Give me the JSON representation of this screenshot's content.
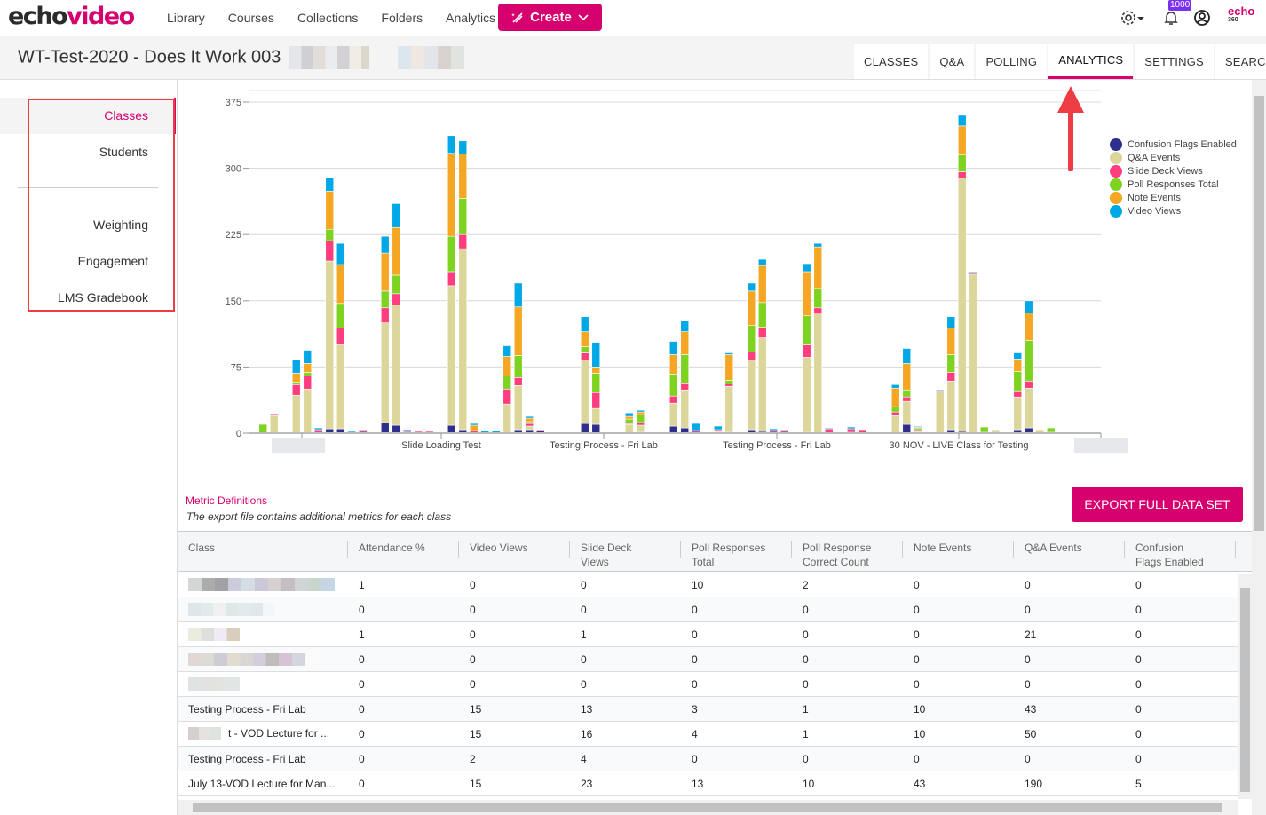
{
  "app": {
    "logo": {
      "part1": "echo",
      "part2": "video"
    },
    "nav": [
      "Library",
      "Courses",
      "Collections",
      "Folders",
      "Analytics"
    ],
    "create_label": "Create",
    "notification_count": "1000",
    "brand_small": {
      "top": "echo",
      "bottom": "360"
    },
    "accent_color": "#d6006f"
  },
  "course": {
    "title": "WT-Test-2020 - Does It Work 003"
  },
  "tabs": [
    {
      "label": "CLASSES",
      "active": false
    },
    {
      "label": "Q&A",
      "active": false
    },
    {
      "label": "POLLING",
      "active": false
    },
    {
      "label": "ANALYTICS",
      "active": true
    },
    {
      "label": "SETTINGS",
      "active": false
    },
    {
      "label": "SEARCH",
      "active": false
    }
  ],
  "sidebar": {
    "items": [
      {
        "label": "Classes",
        "active": true
      },
      {
        "label": "Students",
        "active": false
      },
      {
        "label": "Weighting",
        "active": false
      },
      {
        "label": "Engagement",
        "active": false
      },
      {
        "label": "LMS Gradebook",
        "active": false
      }
    ]
  },
  "chart_data": {
    "type": "bar",
    "stacked": true,
    "title": "",
    "xlabel": "",
    "ylabel": "",
    "ylim": [
      0,
      375
    ],
    "yticks": [
      0,
      75,
      150,
      225,
      300,
      375
    ],
    "grid": true,
    "legend_position": "right",
    "x_tick_labels": [
      "",
      "Slide Loading Test",
      "Testing Process - Fri Lab",
      "Testing Process - Fri Lab",
      "30 NOV - LIVE Class for Testing",
      ""
    ],
    "series": [
      {
        "name": "Confusion Flags Enabled",
        "color": "#2e2e8f"
      },
      {
        "name": "Q&A Events",
        "color": "#dcd69a"
      },
      {
        "name": "Slide Deck Views",
        "color": "#ff3d7f"
      },
      {
        "name": "Poll Responses Total",
        "color": "#7ed321"
      },
      {
        "name": "Note Events",
        "color": "#f5a623"
      },
      {
        "name": "Video Views",
        "color": "#00a8e6"
      }
    ],
    "bars": [
      [
        0,
        0,
        0,
        10,
        0,
        0
      ],
      [
        0,
        20,
        2,
        0,
        0,
        0
      ],
      [
        0,
        0,
        0,
        0,
        0,
        0
      ],
      [
        0,
        43,
        12,
        3,
        10,
        15
      ],
      [
        0,
        50,
        15,
        4,
        10,
        15
      ],
      [
        0,
        0,
        4,
        0,
        0,
        2
      ],
      [
        5,
        190,
        23,
        13,
        43,
        15
      ],
      [
        5,
        95,
        19,
        28,
        44,
        24
      ],
      [
        0,
        0,
        0,
        0,
        0,
        2
      ],
      [
        0,
        0,
        3,
        0,
        0,
        1
      ],
      [
        0,
        0,
        0,
        0,
        0,
        1
      ],
      [
        12,
        113,
        17,
        19,
        43,
        19
      ],
      [
        9,
        136,
        13,
        21,
        54,
        27
      ],
      [
        0,
        0,
        2,
        0,
        0,
        2
      ],
      [
        0,
        0,
        2,
        0,
        0,
        0
      ],
      [
        0,
        0,
        2,
        0,
        0,
        0
      ],
      [
        0,
        0,
        0,
        0,
        0,
        1
      ],
      [
        9,
        158,
        16,
        40,
        94,
        20
      ],
      [
        4,
        205,
        16,
        41,
        50,
        15
      ],
      [
        0,
        0,
        3,
        0,
        6,
        2
      ],
      [
        0,
        0,
        0,
        0,
        0,
        3
      ],
      [
        0,
        0,
        0,
        0,
        0,
        3
      ],
      [
        0,
        33,
        17,
        15,
        22,
        12
      ],
      [
        4,
        50,
        9,
        25,
        55,
        27
      ],
      [
        4,
        4,
        3,
        2,
        4,
        2
      ],
      [
        3,
        0,
        1,
        0,
        0,
        0
      ],
      [
        0,
        0,
        0,
        0,
        0,
        0
      ],
      [
        0,
        0,
        0,
        0,
        0,
        0
      ],
      [
        0,
        0,
        0,
        0,
        0,
        0
      ],
      [
        11,
        72,
        8,
        7,
        17,
        17
      ],
      [
        10,
        18,
        18,
        22,
        7,
        28
      ],
      [
        0,
        0,
        0,
        0,
        0,
        0
      ],
      [
        0,
        0,
        0,
        0,
        0,
        0
      ],
      [
        0,
        10,
        1,
        5,
        3,
        4
      ],
      [
        1,
        8,
        3,
        9,
        3,
        2
      ],
      [
        0,
        0,
        0,
        0,
        0,
        1
      ],
      [
        0,
        0,
        0,
        0,
        0,
        0
      ],
      [
        8,
        26,
        8,
        25,
        22,
        15
      ],
      [
        6,
        43,
        8,
        32,
        26,
        12
      ],
      [
        0,
        0,
        3,
        0,
        0,
        8
      ],
      [
        0,
        0,
        1,
        0,
        0,
        0
      ],
      [
        0,
        2,
        2,
        0,
        0,
        4
      ],
      [
        1,
        52,
        3,
        4,
        29,
        2
      ],
      [
        0,
        0,
        0,
        0,
        0,
        0
      ],
      [
        4,
        79,
        9,
        30,
        39,
        9
      ],
      [
        2,
        106,
        12,
        28,
        42,
        7
      ],
      [
        0,
        0,
        3,
        0,
        0,
        2
      ],
      [
        0,
        0,
        3,
        0,
        0,
        1
      ],
      [
        0,
        0,
        0,
        0,
        0,
        0
      ],
      [
        1,
        85,
        14,
        33,
        50,
        9
      ],
      [
        0,
        135,
        7,
        22,
        47,
        4
      ],
      [
        0,
        0,
        5,
        0,
        0,
        1
      ],
      [
        0,
        0,
        0,
        0,
        0,
        0
      ],
      [
        1,
        0,
        4,
        0,
        0,
        2
      ],
      [
        0,
        0,
        4,
        0,
        0,
        0
      ],
      [
        0,
        0,
        0,
        0,
        0,
        0
      ],
      [
        0,
        0,
        0,
        0,
        0,
        0
      ],
      [
        0,
        20,
        4,
        6,
        21,
        4
      ],
      [
        10,
        26,
        5,
        8,
        30,
        17
      ],
      [
        0,
        2,
        2,
        2,
        1,
        1
      ],
      [
        0,
        0,
        0,
        0,
        0,
        0
      ],
      [
        0,
        47,
        1,
        0,
        0,
        1
      ],
      [
        4,
        55,
        10,
        20,
        30,
        13
      ],
      [
        2,
        287,
        7,
        19,
        33,
        12
      ],
      [
        0,
        180,
        2,
        0,
        0,
        1
      ],
      [
        0,
        0,
        1,
        6,
        0,
        0
      ],
      [
        0,
        4,
        0,
        0,
        0,
        0
      ],
      [
        0,
        0,
        0,
        0,
        0,
        0
      ],
      [
        4,
        37,
        7,
        22,
        14,
        7
      ],
      [
        6,
        45,
        8,
        46,
        31,
        14
      ],
      [
        0,
        3,
        0,
        0,
        1,
        0
      ],
      [
        0,
        0,
        1,
        5,
        0,
        0
      ],
      [
        0,
        0,
        0,
        0,
        0,
        0
      ],
      [
        0,
        0,
        0,
        0,
        0,
        0
      ],
      [
        0,
        0,
        0,
        0,
        0,
        1
      ],
      [
        0,
        0,
        0,
        0,
        0,
        1
      ]
    ]
  },
  "metrics": {
    "definitions_link": "Metric Definitions",
    "export_note": "The export file contains additional metrics for each class",
    "export_button": "EXPORT FULL DATA SET"
  },
  "table": {
    "columns": [
      "Class",
      "Attendance %",
      "Video Views",
      "Slide Deck Views",
      "Poll Responses Total",
      "Poll Response Correct Count",
      "Note Events",
      "Q&A Events",
      "Confusion Flags Enabled"
    ],
    "column_lines": [
      [
        "Class"
      ],
      [
        "Attendance %"
      ],
      [
        "Video Views"
      ],
      [
        "Slide Deck",
        "Views"
      ],
      [
        "Poll Responses",
        "Total"
      ],
      [
        "Poll Response",
        "Correct Count"
      ],
      [
        "Note Events"
      ],
      [
        "Q&A Events"
      ],
      [
        "Confusion",
        "Flags Enabled"
      ]
    ],
    "rows": [
      {
        "class": "",
        "values": [
          "1",
          "0",
          "0",
          "10",
          "2",
          "0",
          "0",
          "0"
        ]
      },
      {
        "class": "",
        "values": [
          "0",
          "0",
          "0",
          "0",
          "0",
          "0",
          "0",
          "0"
        ]
      },
      {
        "class": "",
        "values": [
          "1",
          "0",
          "1",
          "0",
          "0",
          "0",
          "21",
          "0"
        ]
      },
      {
        "class": "",
        "values": [
          "0",
          "0",
          "0",
          "0",
          "0",
          "0",
          "0",
          "0"
        ]
      },
      {
        "class": "",
        "values": [
          "0",
          "0",
          "0",
          "0",
          "0",
          "0",
          "0",
          "0"
        ]
      },
      {
        "class": "Testing Process - Fri Lab",
        "values": [
          "0",
          "15",
          "13",
          "3",
          "1",
          "10",
          "43",
          "0"
        ]
      },
      {
        "class": "t - VOD Lecture for ...",
        "values": [
          "0",
          "15",
          "16",
          "4",
          "1",
          "10",
          "50",
          "0"
        ]
      },
      {
        "class": "Testing Process - Fri Lab",
        "values": [
          "0",
          "2",
          "4",
          "0",
          "0",
          "0",
          "0",
          "0"
        ]
      },
      {
        "class": "July 13-VOD Lecture for Man...",
        "values": [
          "0",
          "15",
          "23",
          "13",
          "10",
          "43",
          "190",
          "5"
        ]
      }
    ]
  }
}
